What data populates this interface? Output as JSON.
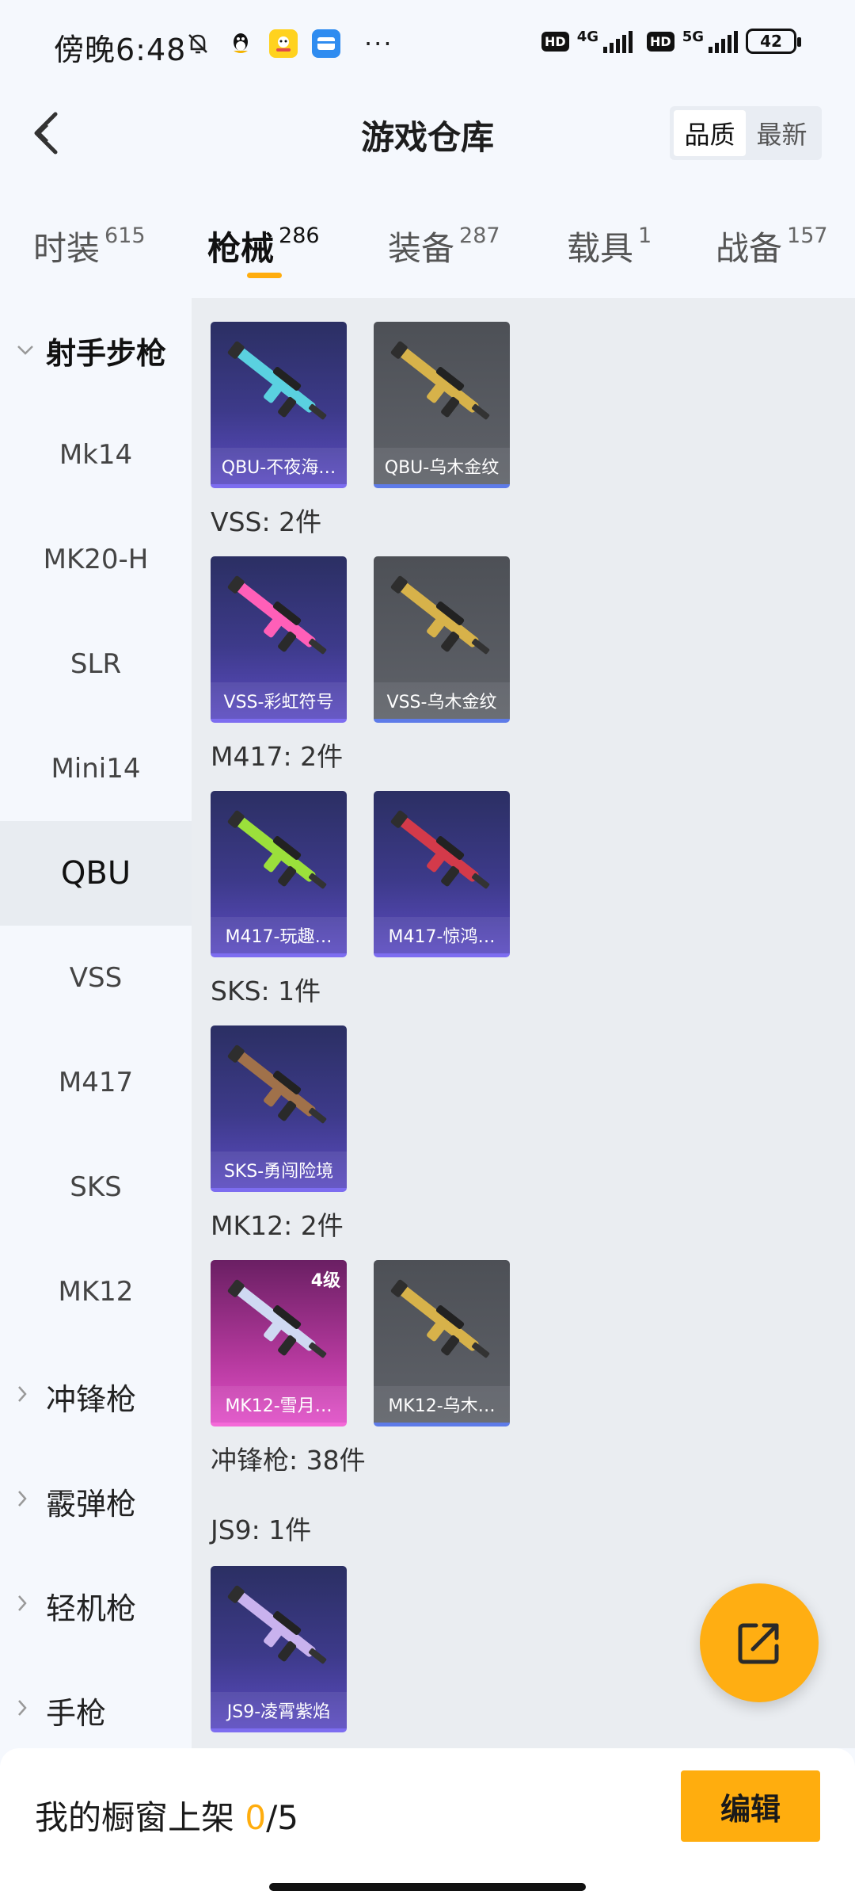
{
  "status_bar": {
    "time": "傍晚6:48",
    "more": "···",
    "network_left": "4G",
    "network_right": "5G",
    "battery": "42"
  },
  "header": {
    "title": "游戏仓库",
    "sort_options": [
      "品质",
      "最新"
    ],
    "sort_selected": "品质"
  },
  "tabs": [
    {
      "label": "时装",
      "count": "615"
    },
    {
      "label": "枪械",
      "count": "286",
      "active": true
    },
    {
      "label": "装备",
      "count": "287"
    },
    {
      "label": "载具",
      "count": "1"
    },
    {
      "label": "战备",
      "count": "157"
    }
  ],
  "sidebar": {
    "items": [
      {
        "label": "射手步枪",
        "type": "group",
        "expanded": true
      },
      {
        "label": "Mk14"
      },
      {
        "label": "MK20-H"
      },
      {
        "label": "SLR"
      },
      {
        "label": "Mini14"
      },
      {
        "label": "QBU",
        "active": true
      },
      {
        "label": "VSS"
      },
      {
        "label": "M417"
      },
      {
        "label": "SKS"
      },
      {
        "label": "MK12"
      },
      {
        "label": "冲锋枪",
        "type": "group"
      },
      {
        "label": "霰弹枪",
        "type": "group"
      },
      {
        "label": "轻机枪",
        "type": "group"
      },
      {
        "label": "手枪",
        "type": "group"
      }
    ]
  },
  "content": {
    "sections": [
      {
        "label": "",
        "items": [
          {
            "name": "QBU-不夜海…",
            "rarity": "purple",
            "color": "#5ad1e0"
          },
          {
            "name": "QBU-乌木金纹",
            "rarity": "grey",
            "color": "#d7b24a"
          }
        ]
      },
      {
        "label": "VSS: 2件",
        "items": [
          {
            "name": "VSS-彩虹符号",
            "rarity": "purple",
            "color": "#ff5fb8"
          },
          {
            "name": "VSS-乌木金纹",
            "rarity": "grey",
            "color": "#d7b24a"
          }
        ]
      },
      {
        "label": "M417: 2件",
        "items": [
          {
            "name": "M417-玩趣…",
            "rarity": "purple",
            "color": "#9be03b"
          },
          {
            "name": "M417-惊鸿…",
            "rarity": "purple",
            "color": "#d33a4a"
          }
        ]
      },
      {
        "label": "SKS: 1件",
        "items": [
          {
            "name": "SKS-勇闯险境",
            "rarity": "purple",
            "color": "#a0714a"
          }
        ]
      },
      {
        "label": "MK12: 2件",
        "items": [
          {
            "name": "MK12-雪月…",
            "rarity": "pink",
            "color": "#cfd9f2",
            "level": "4级"
          },
          {
            "name": "MK12-乌木…",
            "rarity": "grey",
            "color": "#d7b24a"
          }
        ]
      },
      {
        "label": "冲锋枪: 38件",
        "items": []
      },
      {
        "label": "JS9: 1件",
        "items": [
          {
            "name": "JS9-凌霄紫焰",
            "rarity": "purple",
            "color": "#c9b2ee"
          }
        ]
      }
    ]
  },
  "bottom_bar": {
    "label": "我的橱窗上架",
    "current": "0",
    "total": "/5",
    "edit_label": "编辑"
  },
  "colors": {
    "accent": "#ffad0e",
    "purple_card": "#3d3a8a",
    "grey_card": "#5f6269",
    "pink_card": "#b3389c"
  }
}
